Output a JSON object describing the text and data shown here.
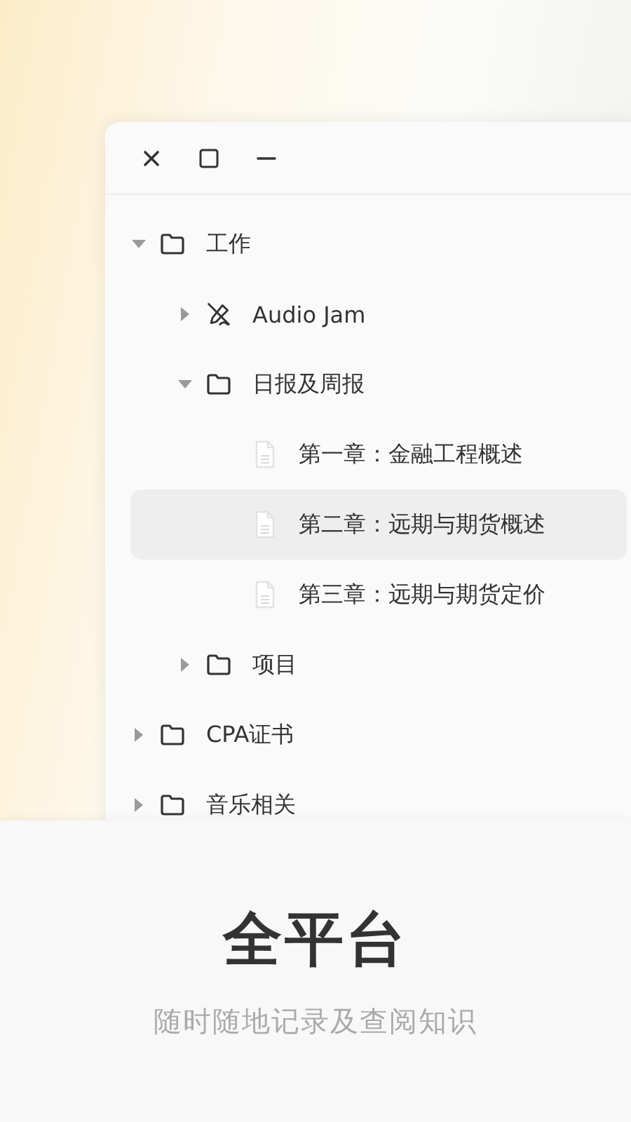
{
  "tree": [
    {
      "label": "工作",
      "kind": "folder",
      "expanded": true,
      "selected": false,
      "children": [
        {
          "label": "Audio Jam",
          "kind": "pen",
          "expanded": false,
          "selected": false
        },
        {
          "label": "日报及周报",
          "kind": "folder",
          "expanded": true,
          "selected": false,
          "children": [
            {
              "label": "第一章：金融工程概述",
              "kind": "document",
              "selected": false
            },
            {
              "label": "第二章：远期与期货概述",
              "kind": "document",
              "selected": true
            },
            {
              "label": "第三章：远期与期货定价",
              "kind": "document",
              "selected": false
            }
          ]
        },
        {
          "label": "项目",
          "kind": "folder",
          "expanded": false,
          "selected": false
        }
      ]
    },
    {
      "label": "CPA证书",
      "kind": "folder",
      "expanded": false,
      "selected": false
    },
    {
      "label": "音乐相关",
      "kind": "folder",
      "expanded": false,
      "selected": false
    }
  ],
  "caption": {
    "title": "全平台",
    "subtitle": "随时随地记录及查阅知识"
  }
}
